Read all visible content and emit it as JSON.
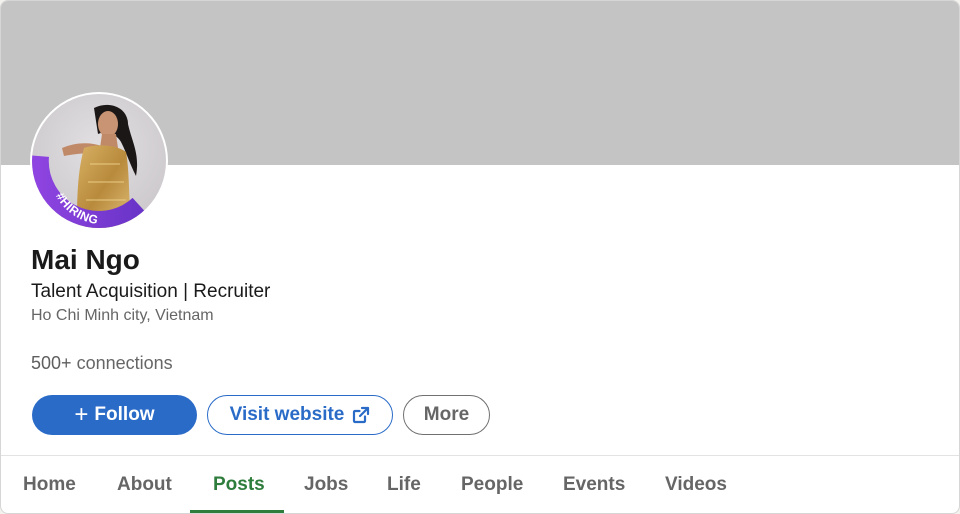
{
  "profile": {
    "name": "Mai Ngo",
    "headline": "Talent Acquisition | Recruiter",
    "location": "Ho Chi Minh city, Vietnam",
    "connections_count": "500+",
    "connections_label": "connections",
    "avatar_badge": "#HIRING"
  },
  "actions": {
    "follow_label": "Follow",
    "follow_icon": "plus-icon",
    "website_label": "Visit website",
    "website_icon": "external-link-icon",
    "more_label": "More"
  },
  "tabs": [
    {
      "label": "Home",
      "active": false
    },
    {
      "label": "About",
      "active": false
    },
    {
      "label": "Posts",
      "active": true
    },
    {
      "label": "Jobs",
      "active": false
    },
    {
      "label": "Life",
      "active": false
    },
    {
      "label": "People",
      "active": false
    },
    {
      "label": "Events",
      "active": false
    },
    {
      "label": "Videos",
      "active": false
    }
  ],
  "colors": {
    "cover": "#c4c4c4",
    "primary": "#2a6bc8",
    "active_tab": "#2e7d3c",
    "hiring_ring": "#7b3fd0",
    "text_dark": "#1a1a1a",
    "text_muted": "#666666"
  }
}
